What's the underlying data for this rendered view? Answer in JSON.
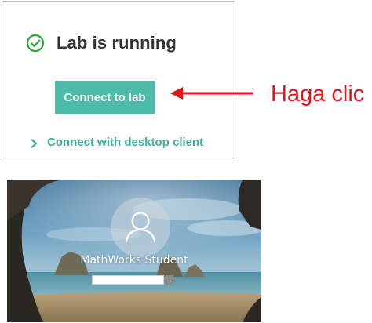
{
  "lab_card": {
    "status_text": "Lab is running",
    "status_icon": "check-circle-icon",
    "connect_button_label": "Connect to lab",
    "desktop_link_label": "Connect with desktop client",
    "desktop_link_icon": "chevron-right-icon",
    "accent_color": "#4cbca8"
  },
  "annotation": {
    "text": "Haga clic",
    "color": "#e8131b",
    "arrow_icon": "left-arrow-icon"
  },
  "login_screen": {
    "user_name": "MathWorks Student",
    "avatar_icon": "user-icon",
    "password_value": "",
    "submit_label": "→",
    "submit_icon": "arrow-right-icon"
  }
}
